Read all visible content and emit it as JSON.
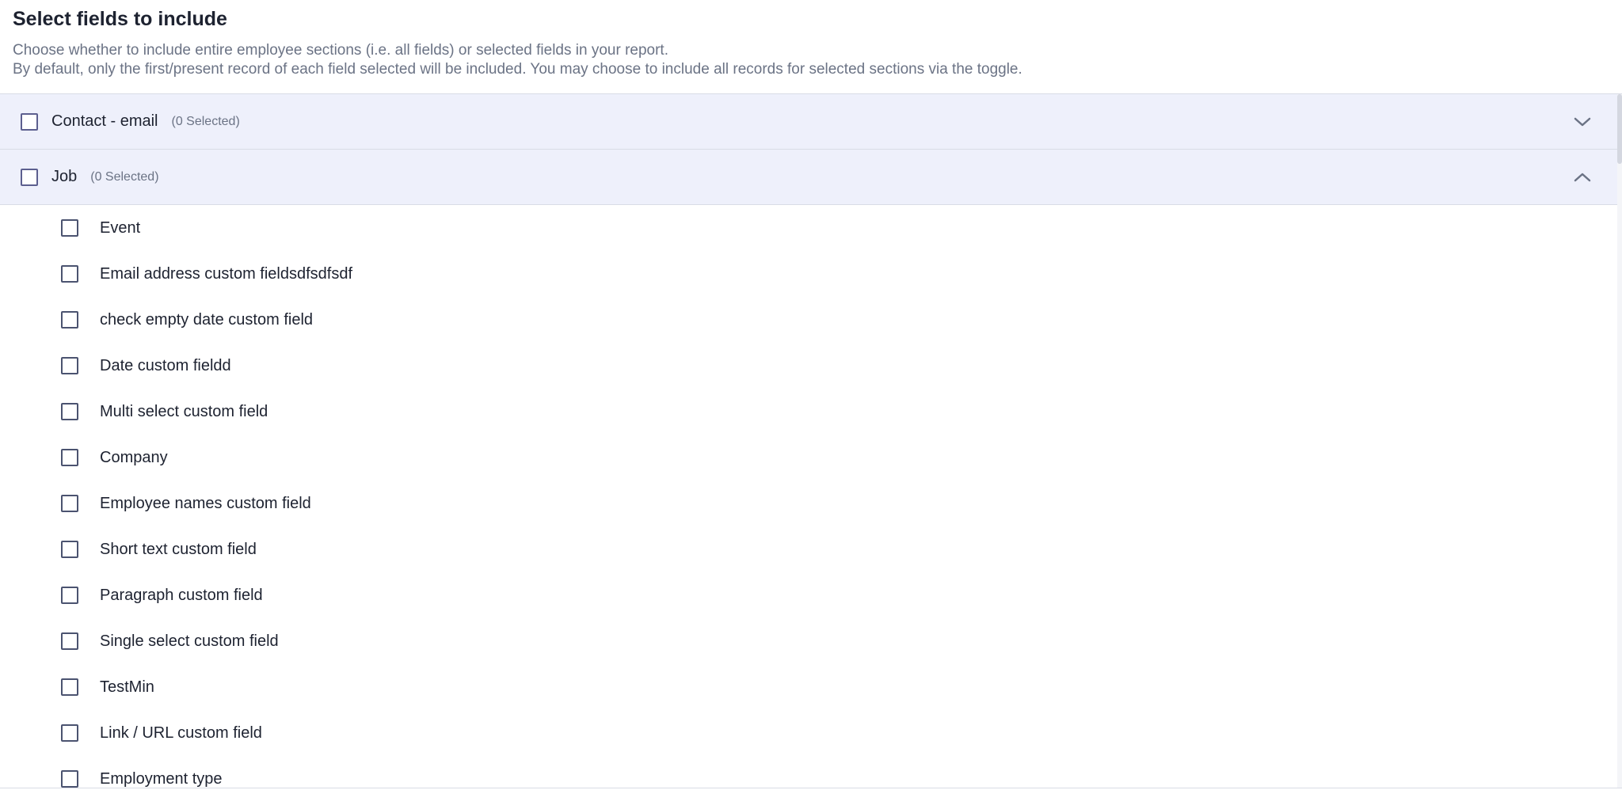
{
  "header": {
    "title": "Select fields to include",
    "desc_line1": "Choose whether to include entire employee sections (i.e. all fields) or selected fields in your report.",
    "desc_line2": "By default, only the first/present record of each field selected will be included. You may choose to include all records for selected sections via the toggle."
  },
  "sections": [
    {
      "name": "Contact - email",
      "count": "(0 Selected)",
      "expanded": false,
      "icon": "chevron-down-icon"
    },
    {
      "name": "Job",
      "count": "(0 Selected)",
      "expanded": true,
      "icon": "chevron-up-icon",
      "fields": [
        "Event",
        "Email address custom fieldsdfsdfsdf",
        "check empty date custom field",
        "Date custom fieldd",
        "Multi select custom field",
        "Company",
        "Employee names custom field",
        "Short text custom field",
        "Paragraph custom field",
        "Single select custom field",
        "TestMin",
        "Link / URL custom field",
        "Employment type"
      ]
    }
  ],
  "colors": {
    "section_bg": "#eef0fb",
    "checkbox_border": "#5c5f8f",
    "muted_text": "#6b7385"
  }
}
